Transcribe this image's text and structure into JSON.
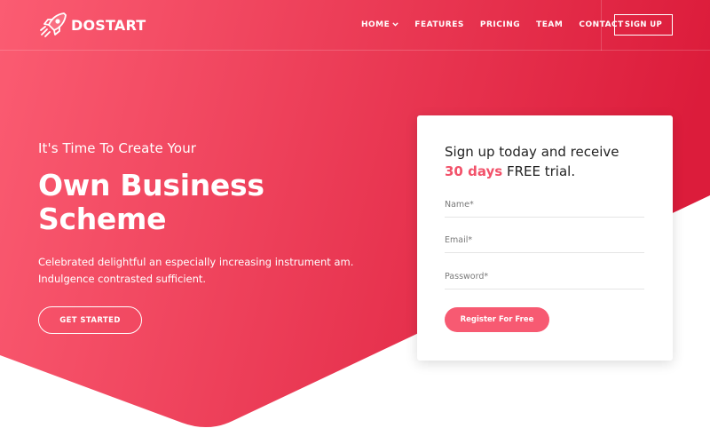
{
  "brand": {
    "name": "DOSTART",
    "icon": "rocket-icon"
  },
  "nav": {
    "items": [
      {
        "label": "HOME",
        "dropdown": true
      },
      {
        "label": "FEATURES"
      },
      {
        "label": "PRICING"
      },
      {
        "label": "TEAM"
      },
      {
        "label": "CONTACT"
      }
    ],
    "signup_label": "SIGN UP"
  },
  "hero": {
    "eyebrow": "It's Time To Create Your",
    "headline": "Own Business Scheme",
    "subtext": "Celebrated delightful an especially increasing instrument am. Indulgence contrasted sufficient.",
    "cta_label": "GET STARTED"
  },
  "form": {
    "title_before": "Sign up today and receive",
    "title_highlight": "30 days",
    "title_after": "FREE trial.",
    "name_placeholder": "Name*",
    "email_placeholder": "Email*",
    "password_placeholder": "Password*",
    "submit_label": "Register For Free"
  },
  "colors": {
    "gradient_start": "#fb5c72",
    "gradient_end": "#dc1c3b",
    "accent": "#f2526a",
    "button": "#f75a72"
  }
}
